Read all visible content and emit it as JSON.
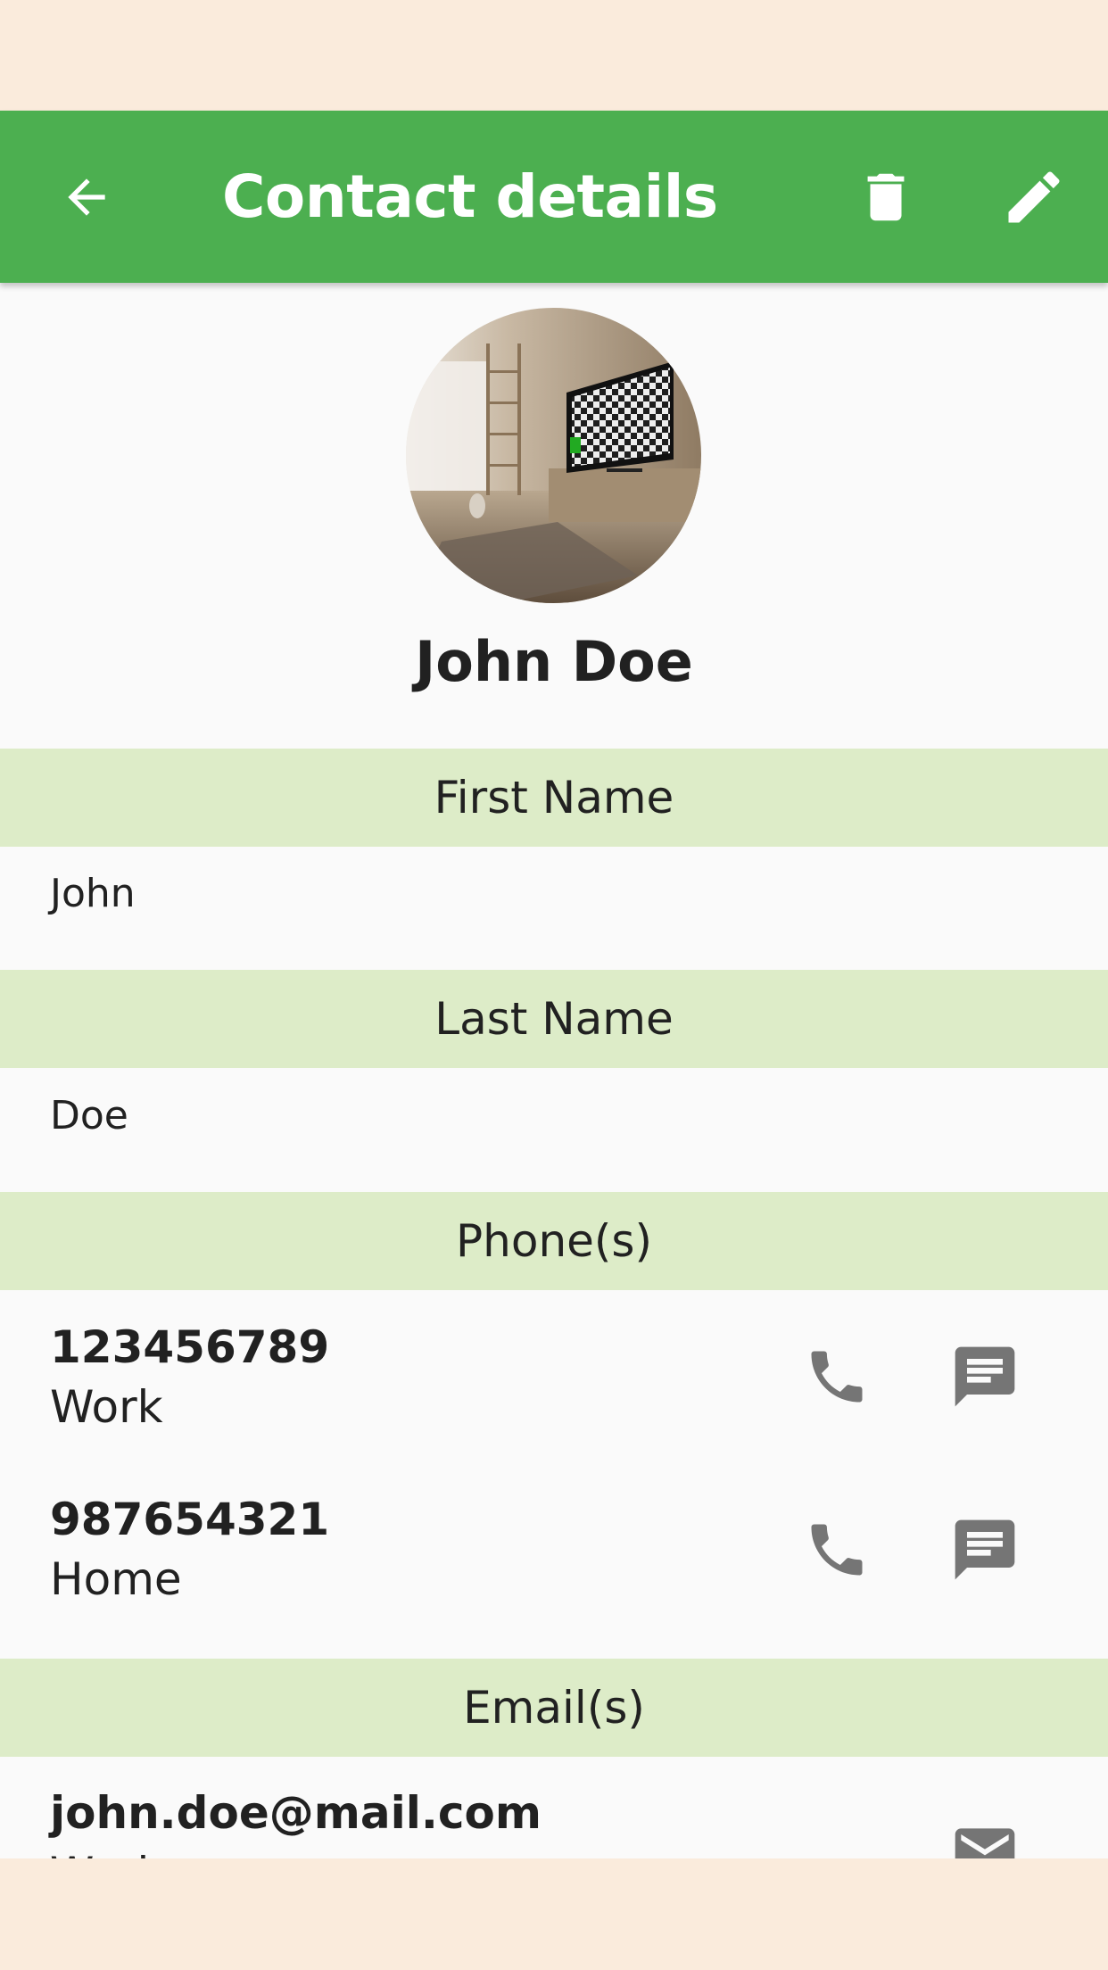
{
  "app_bar": {
    "title": "Contact details",
    "background": "#4CAF50",
    "icons": {
      "back": "arrow-back-icon",
      "delete": "trash-icon",
      "edit": "pencil-icon"
    }
  },
  "contact": {
    "full_name": "John Doe",
    "avatar": "room-photo-avatar"
  },
  "sections": {
    "first_name": {
      "header": "First Name",
      "value": "John"
    },
    "last_name": {
      "header": "Last Name",
      "value": "Doe"
    },
    "phones": {
      "header": "Phone(s)",
      "items": [
        {
          "number": "123456789",
          "label": "Work"
        },
        {
          "number": "987654321",
          "label": "Home"
        }
      ]
    },
    "emails": {
      "header": "Email(s)",
      "items": [
        {
          "address": "john.doe@mail.com",
          "label": "Work"
        }
      ]
    }
  },
  "colors": {
    "header_bg": "#DDECC8",
    "content_bg": "#FAFAFA",
    "icon_gray": "#757575",
    "outer_bg": "#FAEBDC"
  }
}
